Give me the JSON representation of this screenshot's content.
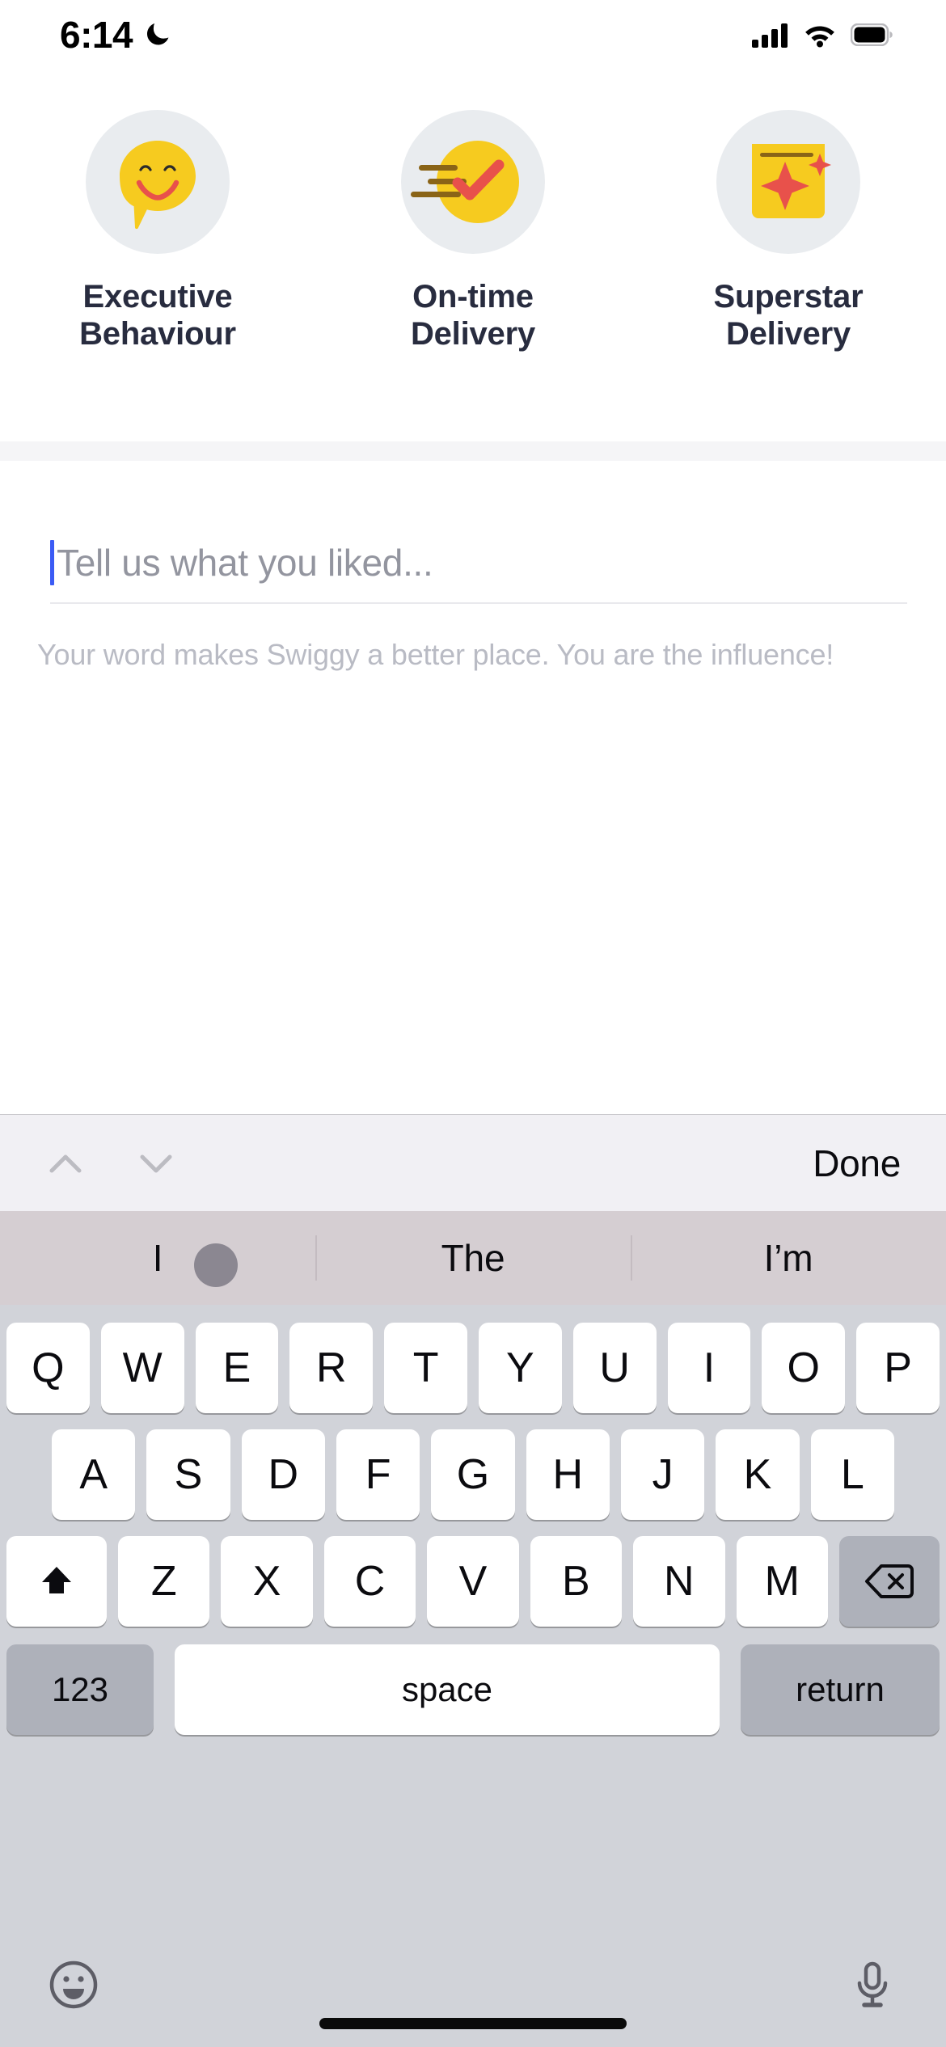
{
  "status_bar": {
    "time": "6:14",
    "icons": [
      "moon-icon",
      "cellular-signal-icon",
      "wifi-icon",
      "battery-icon"
    ]
  },
  "badges": {
    "items": [
      {
        "icon": "smiley-speech-bubble-icon",
        "label": "Executive\nBehaviour",
        "line1": "Executive",
        "line2": "Behaviour"
      },
      {
        "icon": "on-time-check-icon",
        "label": "On-time\nDelivery",
        "line1": "On-time",
        "line2": "Delivery"
      },
      {
        "icon": "superstar-bag-icon",
        "label": "Superstar\nDelivery",
        "line1": "Superstar",
        "line2": "Delivery"
      }
    ]
  },
  "review": {
    "input_value": "",
    "placeholder": "Tell us what you liked...",
    "helper_text": "Your word makes Swiggy a better place. You are the influence!"
  },
  "keyboard_toolbar": {
    "prev_label": "chevron-up-icon",
    "next_label": "chevron-down-icon",
    "done_label": "Done"
  },
  "predictions": [
    "I",
    "The",
    "I’m"
  ],
  "keyboard": {
    "row1": [
      "Q",
      "W",
      "E",
      "R",
      "T",
      "Y",
      "U",
      "I",
      "O",
      "P"
    ],
    "row2": [
      "A",
      "S",
      "D",
      "F",
      "G",
      "H",
      "J",
      "K",
      "L"
    ],
    "row3": [
      "Z",
      "X",
      "C",
      "V",
      "B",
      "N",
      "M"
    ],
    "shift_label": "shift-icon",
    "backspace_label": "backspace-icon",
    "numbers_label": "123",
    "space_label": "space",
    "return_label": "return",
    "emoji_label": "emoji-icon",
    "dictation_label": "microphone-icon"
  },
  "colors": {
    "brand_yellow": "#f6cb1f",
    "accent_coral": "#e8514b",
    "brown": "#8a6417",
    "badge_bg": "#e9ecef",
    "text_dark": "#282c3f",
    "placeholder_grey": "#93959f",
    "helper_grey": "#b9bbc4",
    "caret_blue": "#3b5bf5",
    "keyboard_bg": "#d1d3d9",
    "predictive_bg": "#d5ced2",
    "special_key": "#aeb1ba",
    "toolbar_bg": "#f1f0f4"
  }
}
